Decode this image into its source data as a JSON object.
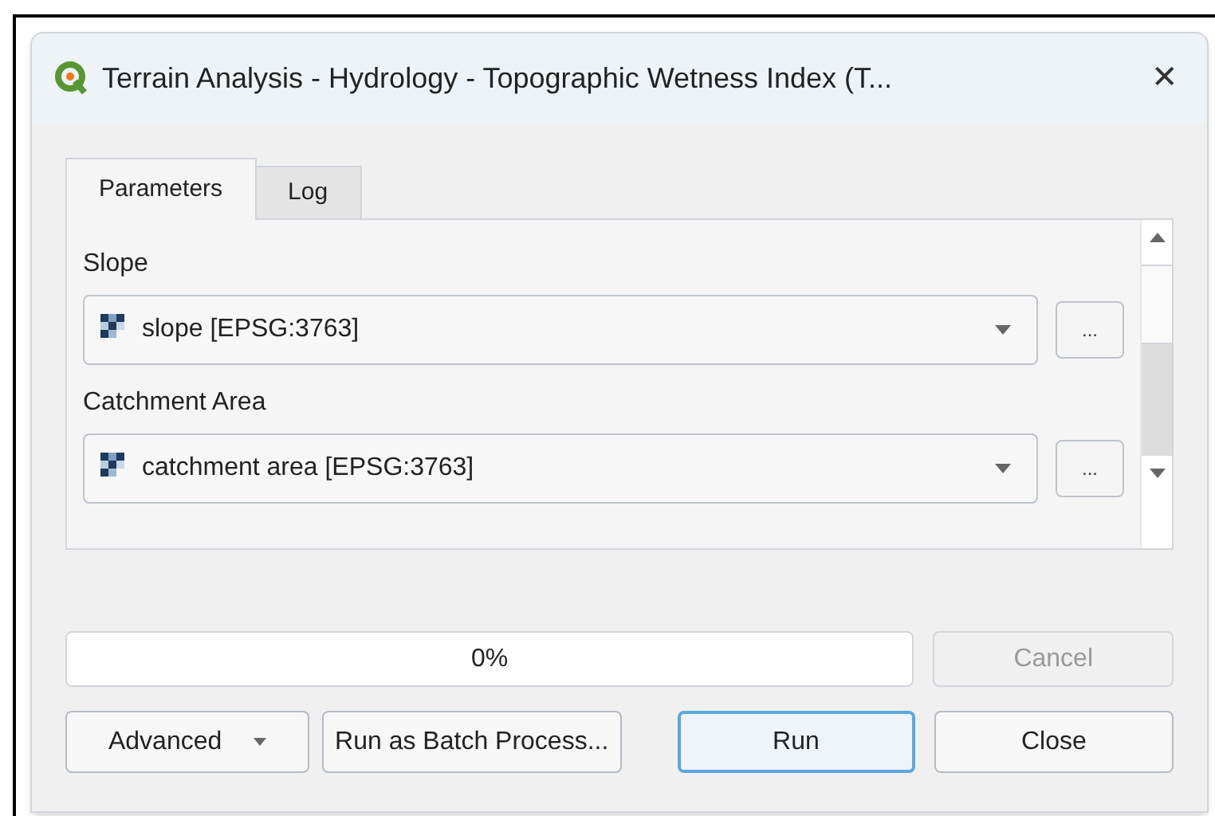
{
  "window": {
    "title": "Terrain Analysis - Hydrology - Topographic Wetness Index (T...",
    "close": "✕"
  },
  "tabs": [
    {
      "label": "Parameters",
      "selected": true
    },
    {
      "label": "Log",
      "selected": false
    }
  ],
  "parameters": [
    {
      "label": "Slope",
      "value": "slope [EPSG:3763]",
      "more": "..."
    },
    {
      "label": "Catchment Area",
      "value": "catchment area [EPSG:3763]",
      "more": "..."
    }
  ],
  "progress": {
    "level": 0,
    "reading": "0%"
  },
  "cancel": {
    "label": "Cancel",
    "disabled": true
  },
  "buttons": [
    {
      "label": "Advanced",
      "kind": "menu",
      "focused": false
    },
    {
      "label": "Run as Batch Process...",
      "kind": "plain",
      "focused": false
    },
    {
      "label": "Run",
      "kind": "plain",
      "focused": true
    },
    {
      "label": "Close",
      "kind": "plain",
      "focused": false
    }
  ]
}
